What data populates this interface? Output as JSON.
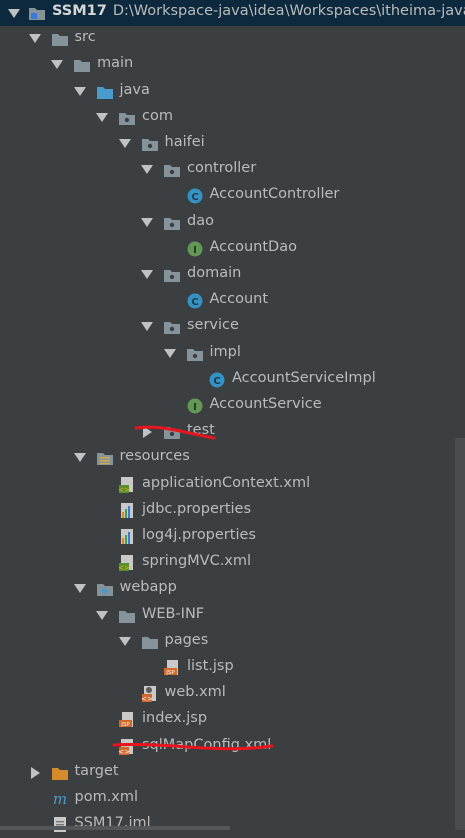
{
  "root": {
    "title": "SSM17",
    "path": "D:\\Workspace-java\\idea\\Workspaces\\itheima-java"
  },
  "rows": [
    {
      "label": "src",
      "icon": "folder-icon",
      "arrow": "down"
    },
    {
      "label": "main",
      "icon": "folder-icon",
      "arrow": "down"
    },
    {
      "label": "java",
      "icon": "source-folder-icon",
      "arrow": "down"
    },
    {
      "label": "com",
      "icon": "package-icon",
      "arrow": "down"
    },
    {
      "label": "haifei",
      "icon": "package-icon",
      "arrow": "down"
    },
    {
      "label": "controller",
      "icon": "package-icon",
      "arrow": "down"
    },
    {
      "label": "AccountController",
      "icon": "class-icon",
      "arrow": ""
    },
    {
      "label": "dao",
      "icon": "package-icon",
      "arrow": "down"
    },
    {
      "label": "AccountDao",
      "icon": "interface-icon",
      "arrow": ""
    },
    {
      "label": "domain",
      "icon": "package-icon",
      "arrow": "down"
    },
    {
      "label": "Account",
      "icon": "class-icon",
      "arrow": ""
    },
    {
      "label": "service",
      "icon": "package-icon",
      "arrow": "down"
    },
    {
      "label": "impl",
      "icon": "package-icon",
      "arrow": "down"
    },
    {
      "label": "AccountServiceImpl",
      "icon": "class-icon",
      "arrow": ""
    },
    {
      "label": "AccountService",
      "icon": "interface-icon",
      "arrow": ""
    },
    {
      "label": "test",
      "icon": "package-icon",
      "arrow": "right"
    },
    {
      "label": "resources",
      "icon": "resources-folder-icon",
      "arrow": "down"
    },
    {
      "label": "applicationContext.xml",
      "icon": "spring-xml-icon",
      "arrow": ""
    },
    {
      "label": "jdbc.properties",
      "icon": "properties-icon",
      "arrow": ""
    },
    {
      "label": "log4j.properties",
      "icon": "properties-icon",
      "arrow": ""
    },
    {
      "label": "springMVC.xml",
      "icon": "spring-xml-icon",
      "arrow": ""
    },
    {
      "label": "webapp",
      "icon": "web-folder-icon",
      "arrow": "down"
    },
    {
      "label": "WEB-INF",
      "icon": "folder-icon",
      "arrow": "down"
    },
    {
      "label": "pages",
      "icon": "folder-icon",
      "arrow": "down"
    },
    {
      "label": "list.jsp",
      "icon": "jsp-icon",
      "arrow": ""
    },
    {
      "label": "web.xml",
      "icon": "web-xml-icon",
      "arrow": ""
    },
    {
      "label": "index.jsp",
      "icon": "jsp-icon",
      "arrow": ""
    },
    {
      "label": "sqlMapConfig.xml",
      "icon": "xml-icon",
      "arrow": ""
    },
    {
      "label": "target",
      "icon": "target-folder-icon",
      "arrow": "right"
    },
    {
      "label": "pom.xml",
      "icon": "maven-icon",
      "arrow": ""
    },
    {
      "label": "SSM17.iml",
      "icon": "iml-icon",
      "arrow": ""
    }
  ],
  "colors": {
    "background": "#3c3f41",
    "selection": "#0d293e",
    "text": "#bbbbbb",
    "annotation": "#e8141e"
  }
}
